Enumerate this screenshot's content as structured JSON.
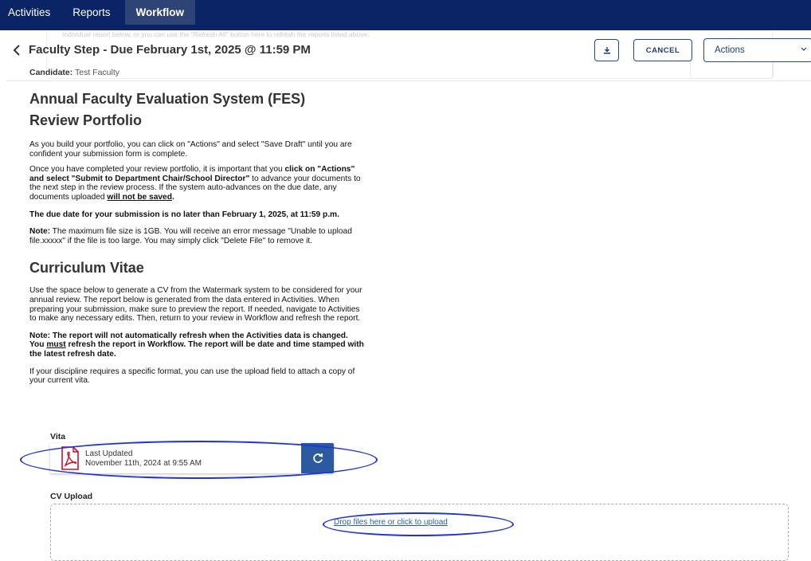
{
  "nav": {
    "tabs": [
      {
        "label": "Activities"
      },
      {
        "label": "Reports"
      },
      {
        "label": "Workflow"
      }
    ]
  },
  "ghost_text": "Individual report below, or you can use the \"Refresh All\" button here to refresh the reports listed above.",
  "header": {
    "title": "Faculty Step - Due February 1st, 2025 @ 11:59 PM",
    "candidate_label": "Candidate:",
    "candidate_name": "Test Faculty",
    "cancel_label": "CANCEL",
    "actions_label": "Actions"
  },
  "main": {
    "title": "Annual Faculty Evaluation System (FES)",
    "subtitle": "Review Portfolio",
    "p1": "As you build your portfolio, you can click on \"Actions\" and select \"Save Draft\" until you are confident your submission form is complete.",
    "p2_a": "Once you have completed your review portfolio, it is important that you ",
    "p2_bold": "click on \"Actions\" and select \"Submit to Department Chair/School Director\"",
    "p2_b": " to advance your documents to the next step in the review process. If the system auto-advances on the due date, any documents uploaded ",
    "p2_underline": "will not be saved",
    "p2_end": ".",
    "due_note": "The due date for your submission is no later than February 1, 2025, at 11:59 p.m.",
    "note_label": "Note:",
    "note_text": " The maximum file size is 1GB. You will receive an error message \"Unable to upload file.xxxxx\" if the file is too large. You may simply click \"Delete File\" to remove it."
  },
  "cv": {
    "heading": "Curriculum Vitae",
    "p1": "Use the space below to generate a CV from the Watermark system to be considered for your annual review. The report below is generated from the data entered in Activities. When preparing your submission, make sure to preview the report. If needed, navigate to Activities to make any necessary edits. Then, return to your review in Workflow and refresh the report.",
    "note_a": "Note: The report will not automatically refresh when the Activities data is changed. You ",
    "note_must": "must",
    "note_b": " refresh the report in Workflow. The report will be date and time stamped with the latest refresh date.",
    "p3": "If your discipline requires a specific format, you can use the upload field to attach a copy of your current vita."
  },
  "vita": {
    "label": "Vita",
    "last_updated_label": "Last Updated",
    "last_updated_value": "November 11th, 2024 at 9:55 AM",
    "pdf_icon_text": "PDF"
  },
  "upload": {
    "label": "CV Upload",
    "drop_text": "Drop files here or click to upload"
  },
  "colors": {
    "nav_bg": "#0b2466",
    "accent": "#2c5aa0",
    "annotation": "#2233d6",
    "pdf_red": "#c8102e"
  }
}
